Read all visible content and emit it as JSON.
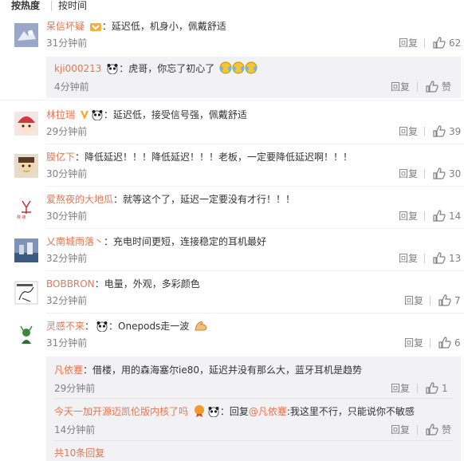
{
  "tabs": {
    "hot": "按热度",
    "time": "按时间"
  },
  "labels": {
    "reply": "回复",
    "like_text": "赞",
    "colon": "："
  },
  "comments": [
    {
      "user": "呆信坏疑",
      "text": "延迟低，机身小，佩戴舒适",
      "time": "31分钟前",
      "likes": "62"
    },
    {
      "user": "林拉瑞",
      "text": "延迟低，接受信号强，佩戴舒适",
      "time": "29分钟前",
      "likes": "39"
    },
    {
      "user": "膜亿下",
      "text": "降低延迟！！！降低延迟！！！老板，一定要降低延迟啊！！！",
      "time": "30分钟前",
      "likes": "30"
    },
    {
      "user": "爱熬夜的大地瓜",
      "text": "就等这个了，延迟一定要没有才行！！！",
      "time": "30分钟前",
      "likes": "14"
    },
    {
      "user": "乂南城雨落丶",
      "text": "充电时间更短，连接稳定的耳机最好",
      "time": "32分钟前",
      "likes": "13"
    },
    {
      "user": "BOBBRON",
      "text": "电量，外观，多彩颜色",
      "time": "32分钟前",
      "likes": "7"
    },
    {
      "user": "灵感不来",
      "text": "Onepods走一波",
      "time": "31分钟前",
      "likes": "6"
    }
  ],
  "replies": [
    {
      "user": "kji000213",
      "text": "虎哥，你忘了初心了",
      "time": "4分钟前",
      "likes": "赞"
    },
    {
      "user": "凡依蹇",
      "text": "借楼，用的森海塞尔ie80，延迟并没有那么大，蓝牙耳机是趋势",
      "time": "29分钟前",
      "likes": "1"
    },
    {
      "user": "今天一加开源迈凯伦版内核了吗",
      "reply_word": "回复",
      "mention": "@凡依蹇",
      "text": ":我这里不行，只能说你不敏感",
      "time": "14分钟前",
      "likes": "赞"
    }
  ],
  "more_replies": "共10条回复",
  "colors": {
    "username": "#eb7350",
    "text": "#333333",
    "meta": "#808080",
    "link": "#eb7350"
  }
}
